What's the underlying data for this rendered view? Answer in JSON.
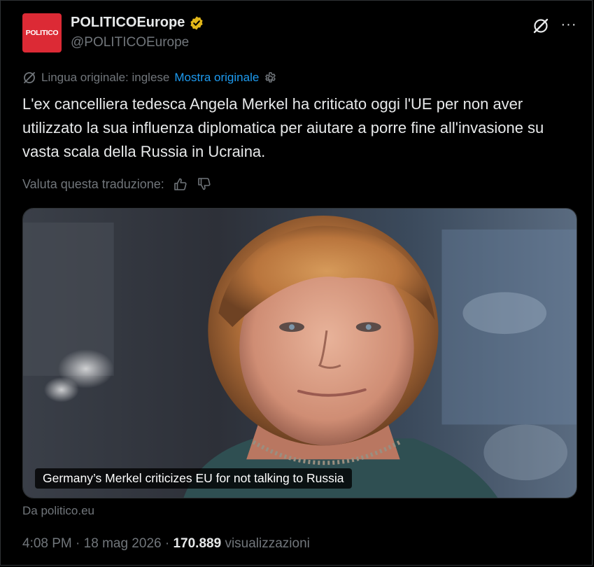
{
  "header": {
    "avatar_text": "POLITICO",
    "display_name": "POLITICOEurope",
    "handle": "@POLITICOEurope"
  },
  "translation": {
    "original_language": "Lingua originale: inglese",
    "show_original": "Mostra originale"
  },
  "tweet": {
    "text": "L'ex cancelliera tedesca Angela Merkel ha criticato oggi l'UE per non aver utilizzato la sua influenza diplomatica per aiutare a porre fine all'invasione su vasta scala della Russia in Ucraina."
  },
  "rating": {
    "label": "Valuta questa traduzione:"
  },
  "card": {
    "caption": "Germany’s Merkel criticizes EU for not talking to Russia",
    "source": "Da politico.eu"
  },
  "meta": {
    "time": "4:08 PM",
    "separator": "·",
    "date": "18 mag 2026",
    "views_count": "170.889",
    "views_label": "visualizzazioni"
  },
  "colors": {
    "accent": "#1d9bf0",
    "brand": "#dc2a35",
    "verified": "#e2b719",
    "muted": "#71767b"
  }
}
